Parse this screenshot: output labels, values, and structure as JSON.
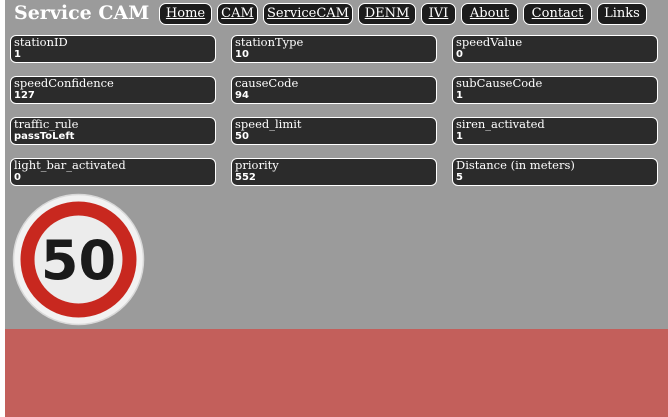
{
  "app": {
    "title": "Service CAM"
  },
  "nav": {
    "items": [
      {
        "label": "Home"
      },
      {
        "label": "CAM"
      },
      {
        "label": "ServiceCAM"
      },
      {
        "label": "DENM"
      },
      {
        "label": "IVI"
      },
      {
        "label": "About"
      },
      {
        "label": "Contact"
      },
      {
        "label": "Links"
      }
    ]
  },
  "fields": [
    {
      "label": "stationID",
      "value": "1"
    },
    {
      "label": "stationType",
      "value": "10"
    },
    {
      "label": "speedValue",
      "value": "0"
    },
    {
      "label": "speedConfidence",
      "value": "127"
    },
    {
      "label": "causeCode",
      "value": "94"
    },
    {
      "label": "subCauseCode",
      "value": "1"
    },
    {
      "label": "traffic_rule",
      "value": "passToLeft"
    },
    {
      "label": "speed_limit",
      "value": "50"
    },
    {
      "label": "siren_activated",
      "value": "1"
    },
    {
      "label": "light_bar_activated",
      "value": "0"
    },
    {
      "label": "priority",
      "value": "552"
    },
    {
      "label": "Distance (in meters)",
      "value": "5"
    }
  ],
  "sign": {
    "icon": "speed-limit-sign-icon",
    "text": "50"
  },
  "colors": {
    "background": "#9b9b9b",
    "card": "#2b2b2b",
    "band": "#c35f5b",
    "sign_ring": "#c8281f"
  }
}
